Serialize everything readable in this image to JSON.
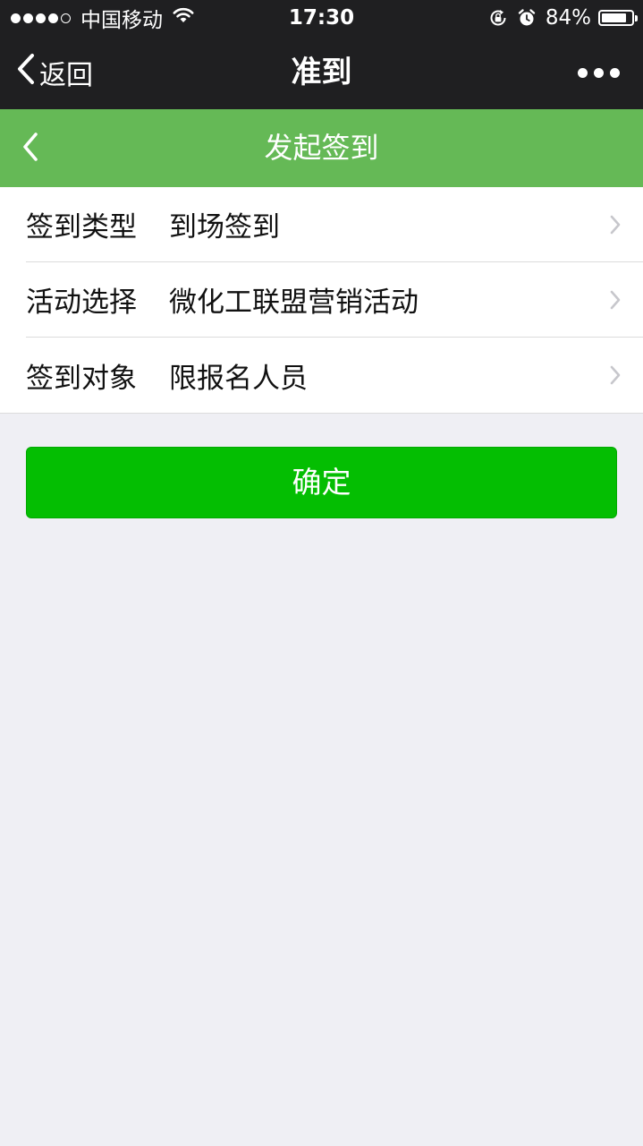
{
  "status_bar": {
    "carrier": "中国移动",
    "time": "17:30",
    "battery_percent_label": "84%",
    "battery_level": 0.84,
    "icons": [
      "signal-dots",
      "wifi-icon",
      "rotation-lock-icon",
      "alarm-icon",
      "battery-icon"
    ]
  },
  "nav": {
    "back_label": "返回",
    "title": "准到",
    "icons": [
      "chevron-left-icon",
      "more-icon"
    ]
  },
  "page_header": {
    "title": "发起签到",
    "icons": [
      "chevron-left-icon"
    ],
    "background_color": "#65b956"
  },
  "form": {
    "rows": [
      {
        "label": "签到类型",
        "value": "到场签到"
      },
      {
        "label": "活动选择",
        "value": "微化工联盟营销活动"
      },
      {
        "label": "签到对象",
        "value": "限报名人员"
      }
    ]
  },
  "confirm_button": {
    "label": "确定",
    "color": "#04be02"
  }
}
